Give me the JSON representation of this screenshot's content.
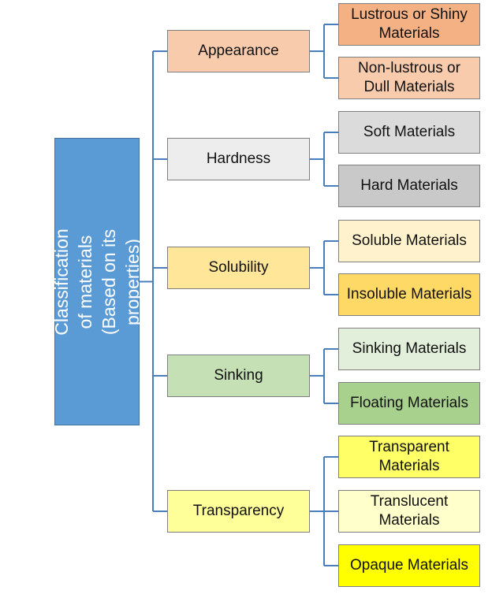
{
  "root": {
    "label": "Classification of materials\n(Based on its properties)",
    "color": "#5b9bd5"
  },
  "connector_color": "#4a7ebb",
  "categories": [
    {
      "label": "Appearance",
      "color": "#f8cbad",
      "children": [
        {
          "label": "Lustrous or Shiny\nMaterials",
          "color": "#f4b183"
        },
        {
          "label": "Non-lustrous or\nDull Materials",
          "color": "#f8cbad"
        }
      ]
    },
    {
      "label": "Hardness",
      "color": "#ededed",
      "children": [
        {
          "label": "Soft Materials",
          "color": "#dbdbdb"
        },
        {
          "label": "Hard Materials",
          "color": "#c9c9c9"
        }
      ]
    },
    {
      "label": "Solubility",
      "color": "#ffe699",
      "children": [
        {
          "label": "Soluble Materials",
          "color": "#fff2cc"
        },
        {
          "label": "Insoluble Materials",
          "color": "#ffd966"
        }
      ]
    },
    {
      "label": "Sinking",
      "color": "#c5e0b4",
      "children": [
        {
          "label": "Sinking Materials",
          "color": "#e2efda"
        },
        {
          "label": "Floating Materials",
          "color": "#a9d18e"
        }
      ]
    },
    {
      "label": "Transparency",
      "color": "#ffff99",
      "children": [
        {
          "label": "Transparent\nMaterials",
          "color": "#ffff66"
        },
        {
          "label": "Translucent\nMaterials",
          "color": "#ffffcc"
        },
        {
          "label": "Opaque Materials",
          "color": "#ffff00"
        }
      ]
    }
  ]
}
